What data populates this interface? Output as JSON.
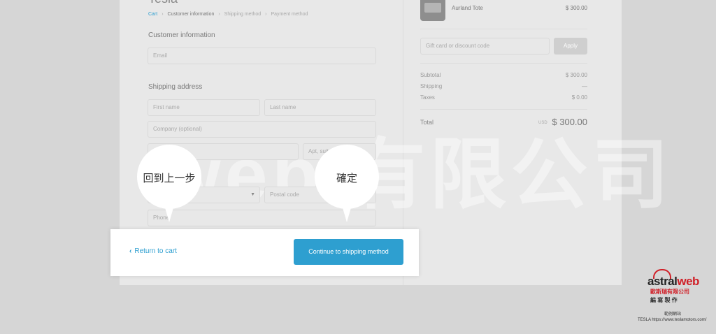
{
  "header": {
    "store_name": "Tesla"
  },
  "breadcrumb": [
    "Cart",
    "Customer information",
    "Shipping method",
    "Payment method"
  ],
  "customer": {
    "section_title": "Customer information",
    "email_placeholder": "Email"
  },
  "shipping": {
    "section_title": "Shipping address",
    "first_name_placeholder": "First name",
    "last_name_placeholder": "Last name",
    "company_placeholder": "Company (optional)",
    "apt_placeholder": "Apt, suite, etc.",
    "postal_placeholder": "Postal code",
    "phone_placeholder": "Phone"
  },
  "footer": {
    "return_label": "Return to cart",
    "continue_label": "Continue to shipping method"
  },
  "order": {
    "product_name": "Aurland Tote",
    "product_price": "$ 300.00",
    "discount_placeholder": "Gift card or discount code",
    "apply_label": "Apply",
    "subtotal_label": "Subtotal",
    "subtotal_value": "$ 300.00",
    "shipping_label": "Shipping",
    "shipping_value": "—",
    "taxes_label": "Taxes",
    "taxes_value": "$ 0.00",
    "total_label": "Total",
    "total_currency": "USD",
    "total_value": "$ 300.00"
  },
  "callouts": {
    "back": "回到上一步",
    "confirm": "確定"
  },
  "branding": {
    "logo_text_1": "astral",
    "logo_text_2": "web",
    "company_cn": "歐斯瑞有限公司",
    "credit_cn": "編 寫 製 作",
    "example_label": "範例網站",
    "example_url": "TESLA https://www.teslamotors.com/",
    "watermark": "web 有限公司"
  },
  "colors": {
    "accent": "#2e9fd0",
    "brand_red": "#d01f27"
  }
}
